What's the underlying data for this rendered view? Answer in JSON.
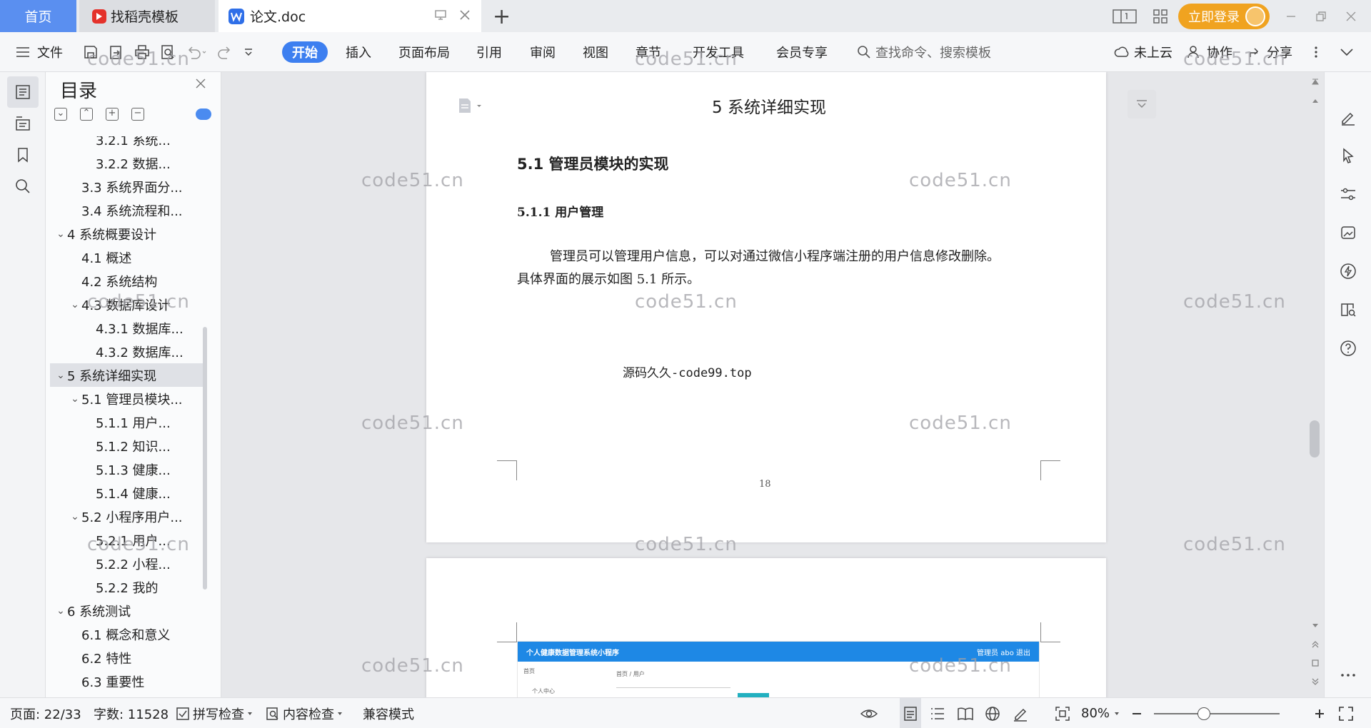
{
  "titlebar": {
    "tabs": [
      {
        "label": "首页"
      },
      {
        "label": "找稻壳模板"
      },
      {
        "label": "论文.doc"
      }
    ],
    "login_label": "立即登录"
  },
  "ribbon": {
    "file_label": "文件",
    "menus": [
      "开始",
      "插入",
      "页面布局",
      "引用",
      "审阅",
      "视图",
      "章节",
      "开发工具",
      "会员专享"
    ],
    "search_placeholder": "查找命令、搜索模板",
    "cloud_label": "未上云",
    "collab_label": "协作",
    "share_label": "分享"
  },
  "outline": {
    "title": "目录",
    "items": [
      {
        "label": "3.2.1 系统..."
      },
      {
        "label": "3.2.2 数据..."
      },
      {
        "label": "3.3 系统界面分..."
      },
      {
        "label": "3.4 系统流程和..."
      },
      {
        "label": "4 系统概要设计"
      },
      {
        "label": "4.1 概述"
      },
      {
        "label": "4.2 系统结构"
      },
      {
        "label": "4.3 数据库设计"
      },
      {
        "label": "4.3.1 数据库..."
      },
      {
        "label": "4.3.2 数据库..."
      },
      {
        "label": "5 系统详细实现"
      },
      {
        "label": "5.1  管理员模块..."
      },
      {
        "label": "5.1.1  用户..."
      },
      {
        "label": "5.1.2  知识..."
      },
      {
        "label": "5.1.3  健康..."
      },
      {
        "label": "5.1.4  健康..."
      },
      {
        "label": "5.2  小程序用户..."
      },
      {
        "label": "5.2.1 用户..."
      },
      {
        "label": "5.2.2 小程..."
      },
      {
        "label": "5.2.2 我的"
      },
      {
        "label": "6 系统测试"
      },
      {
        "label": "6.1 概念和意义"
      },
      {
        "label": "6.2 特性"
      },
      {
        "label": "6.3 重要性"
      }
    ]
  },
  "document": {
    "chapter_title": "5 系统详细实现",
    "section_title": "5.1  管理员模块的实现",
    "subsection_title": "5.1.1  用户管理",
    "paragraph_line1": "管理员可以管理用户信息，可以对通过微信小程序端注册的用户信息修改删除。",
    "paragraph_line2": "具体界面的展示如图 5.1 所示。",
    "source_note": "源码久久-code99.top",
    "page_number": "18",
    "app_title": "个人健康数据管理系统小程序",
    "app_user": "管理员 abo   退出",
    "app_nav_home": "首页",
    "app_nav_center": "个人中心",
    "app_breadcrumb": "首页 / 用户"
  },
  "watermark": "code51.cn",
  "status": {
    "page": "页面: 22/33",
    "words": "字数: 11528",
    "spell": "拼写检查",
    "content": "内容检查",
    "compat": "兼容模式",
    "zoom": "80%",
    "zoom_fraction": 0.4
  },
  "colors": {
    "accent": "#3d7ff0",
    "login": "#f0a320",
    "home_tab": "#5a8ff0",
    "wps_red": "#e4322b",
    "wps_blue": "#2f6fe8"
  }
}
